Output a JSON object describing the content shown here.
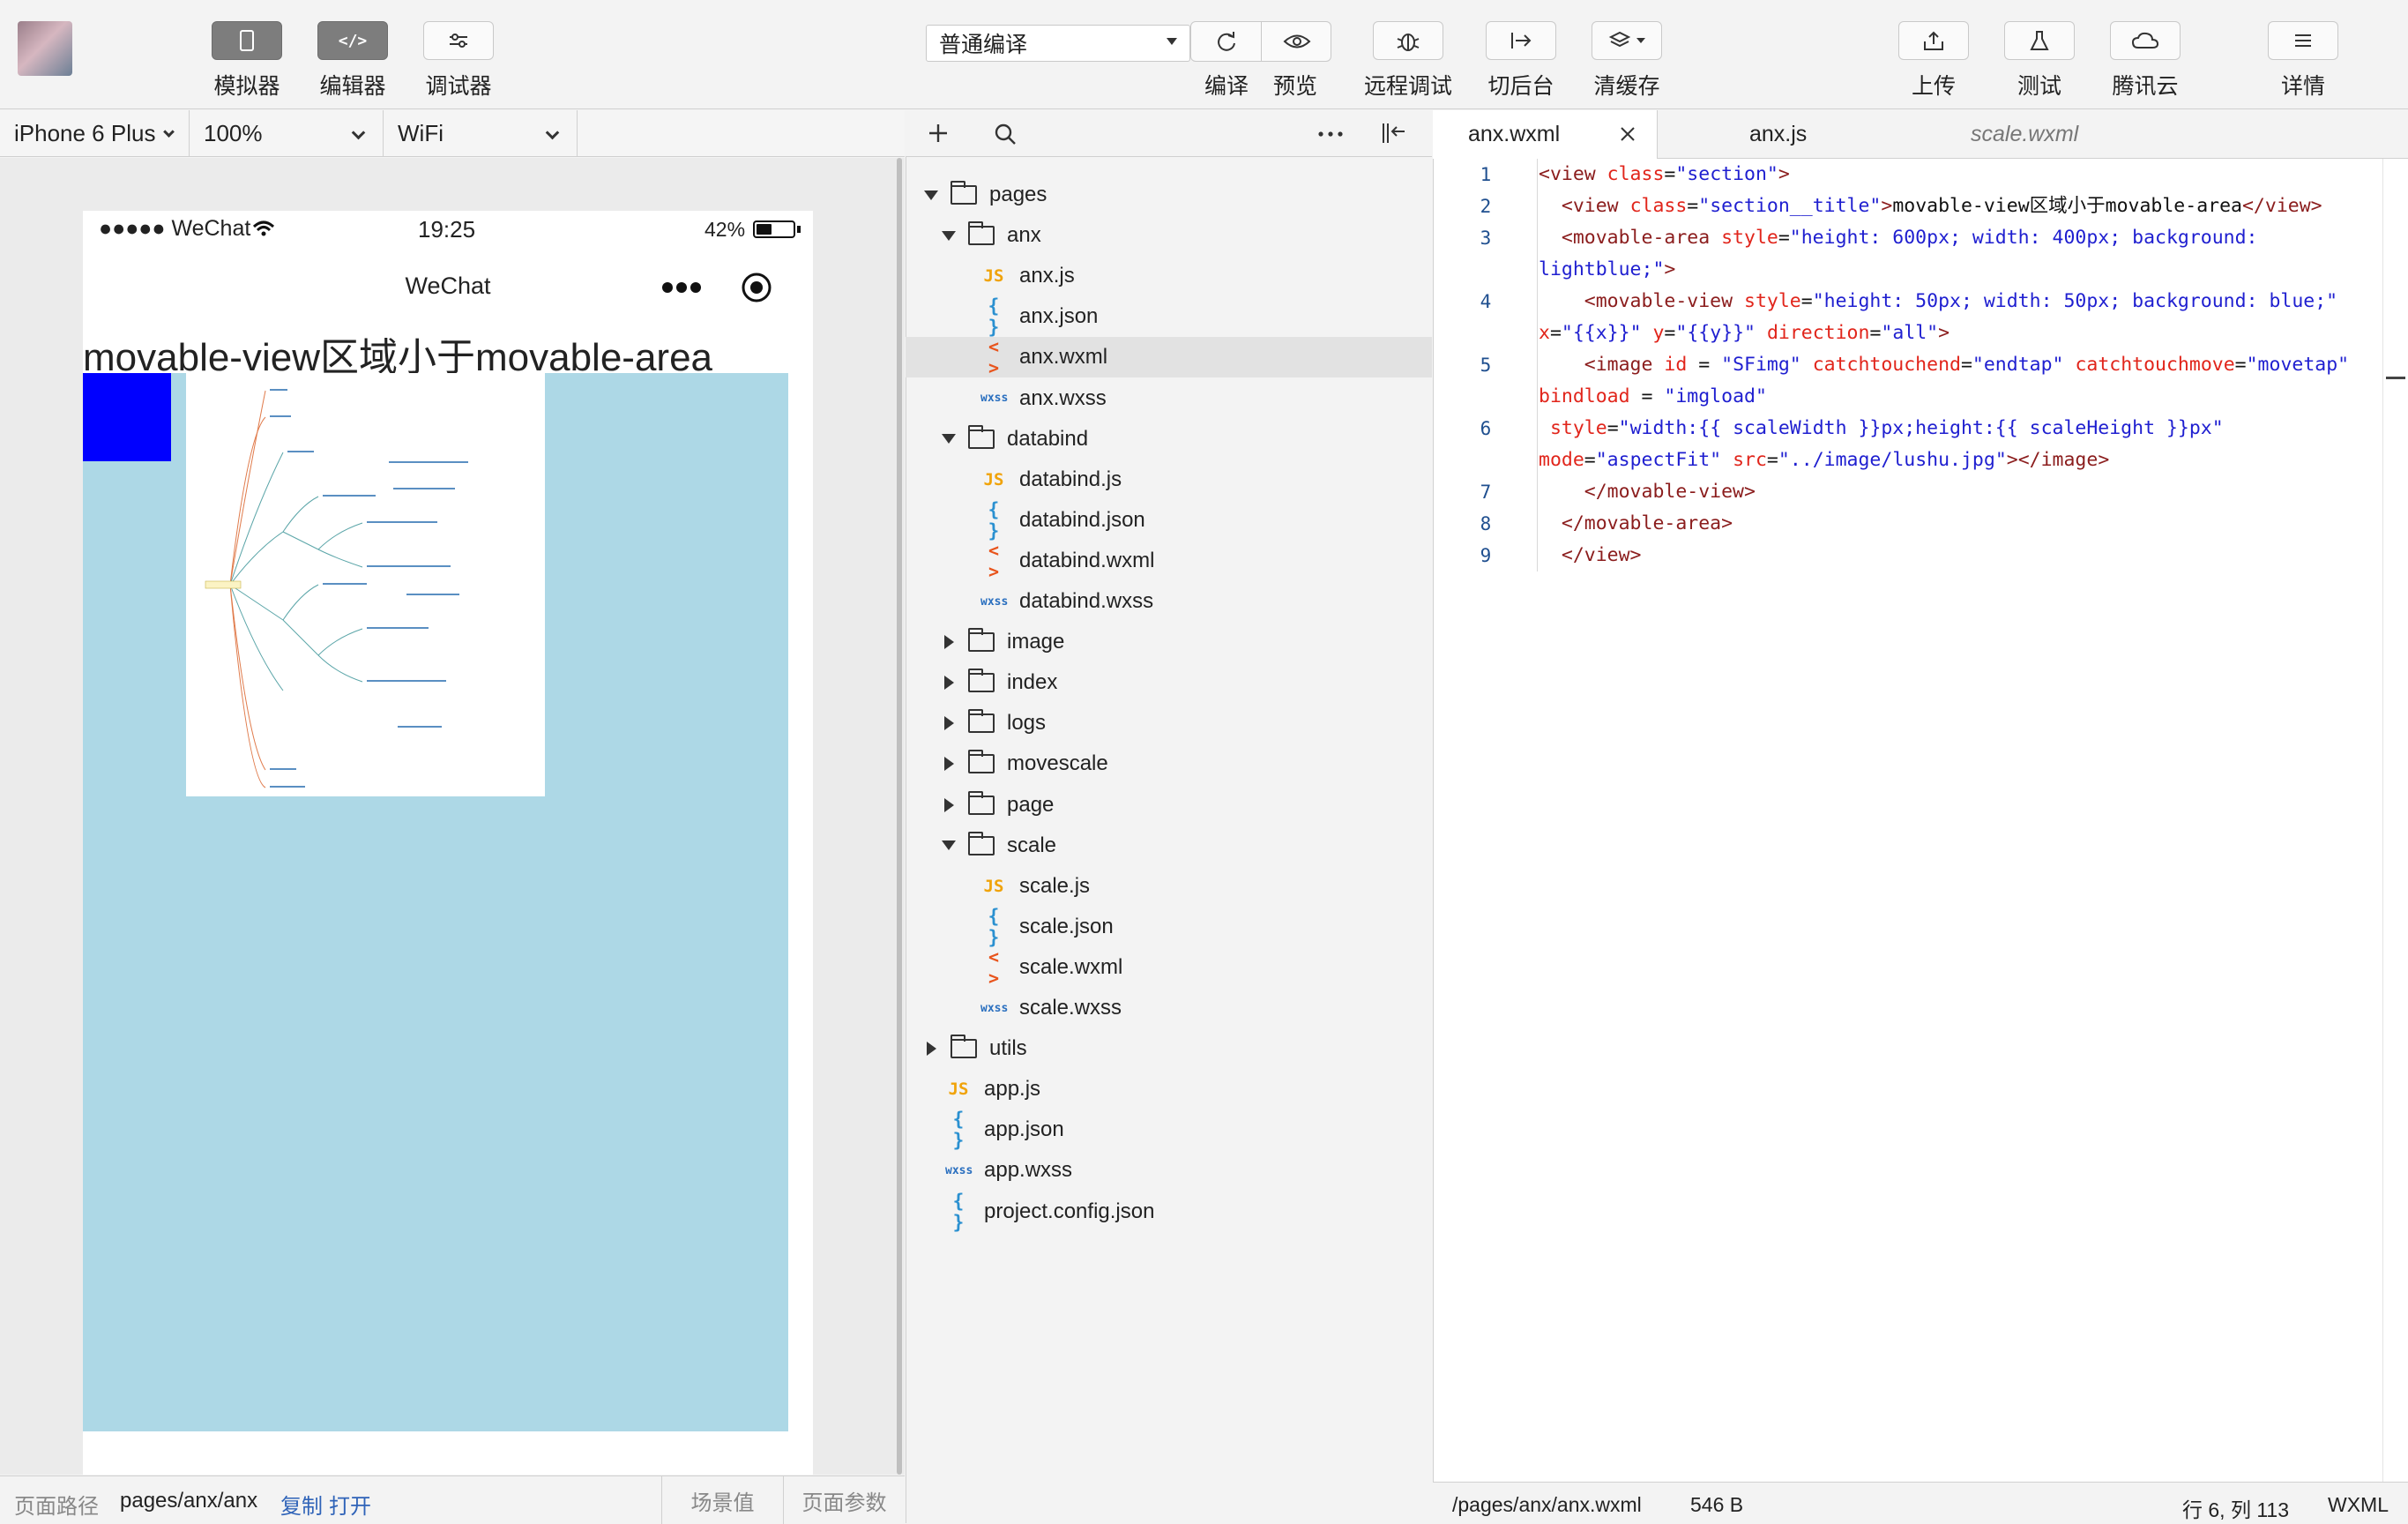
{
  "toolbar": {
    "left_buttons": [
      {
        "label": "模拟器",
        "icon": "phone-icon"
      },
      {
        "label": "编辑器",
        "icon": "code-icon"
      },
      {
        "label": "调试器",
        "icon": "sliders-icon"
      }
    ],
    "compile_mode": "普通编译",
    "mid_buttons": [
      {
        "label": "编译",
        "icon": "refresh-icon"
      },
      {
        "label": "预览",
        "icon": "eye-icon"
      },
      {
        "label": "远程调试",
        "icon": "bug-icon"
      },
      {
        "label": "切后台",
        "icon": "switch-icon"
      },
      {
        "label": "清缓存",
        "icon": "layers-icon"
      }
    ],
    "right_buttons": [
      {
        "label": "上传",
        "icon": "upload-icon"
      },
      {
        "label": "测试",
        "icon": "flask-icon"
      },
      {
        "label": "腾讯云",
        "icon": "cloud-icon"
      },
      {
        "label": "详情",
        "icon": "menu-icon"
      }
    ]
  },
  "device_bar": {
    "device": "iPhone 6 Plus",
    "zoom": "100%",
    "network": "WiFi"
  },
  "phone": {
    "carrier": "●●●●● WeChat",
    "time": "19:25",
    "battery": "42%",
    "battery_level": 0.42,
    "nav_title": "WeChat",
    "section_title": "movable-view区域小于movable-area"
  },
  "explorer": {
    "tree": [
      {
        "type": "folder",
        "name": "pages",
        "level": 0,
        "open": true
      },
      {
        "type": "folder",
        "name": "anx",
        "level": 1,
        "open": true
      },
      {
        "type": "js",
        "name": "anx.js",
        "level": 2
      },
      {
        "type": "json",
        "name": "anx.json",
        "level": 2
      },
      {
        "type": "wxml",
        "name": "anx.wxml",
        "level": 2,
        "selected": true
      },
      {
        "type": "wxss",
        "name": "anx.wxss",
        "level": 2
      },
      {
        "type": "folder",
        "name": "databind",
        "level": 1,
        "open": true
      },
      {
        "type": "js",
        "name": "databind.js",
        "level": 2
      },
      {
        "type": "json",
        "name": "databind.json",
        "level": 2
      },
      {
        "type": "wxml",
        "name": "databind.wxml",
        "level": 2
      },
      {
        "type": "wxss",
        "name": "databind.wxss",
        "level": 2
      },
      {
        "type": "folder",
        "name": "image",
        "level": 1,
        "open": false
      },
      {
        "type": "folder",
        "name": "index",
        "level": 1,
        "open": false
      },
      {
        "type": "folder",
        "name": "logs",
        "level": 1,
        "open": false
      },
      {
        "type": "folder",
        "name": "movescale",
        "level": 1,
        "open": false
      },
      {
        "type": "folder",
        "name": "page",
        "level": 1,
        "open": false
      },
      {
        "type": "folder",
        "name": "scale",
        "level": 1,
        "open": true
      },
      {
        "type": "js",
        "name": "scale.js",
        "level": 2
      },
      {
        "type": "json",
        "name": "scale.json",
        "level": 2
      },
      {
        "type": "wxml",
        "name": "scale.wxml",
        "level": 2
      },
      {
        "type": "wxss",
        "name": "scale.wxss",
        "level": 2
      },
      {
        "type": "folder",
        "name": "utils",
        "level": 0,
        "open": false
      },
      {
        "type": "js",
        "name": "app.js",
        "level": 0
      },
      {
        "type": "json",
        "name": "app.json",
        "level": 0
      },
      {
        "type": "wxss",
        "name": "app.wxss",
        "level": 0
      },
      {
        "type": "json",
        "name": "project.config.json",
        "level": 0
      }
    ]
  },
  "editor": {
    "tabs": [
      "anx.wxml",
      "anx.js",
      "scale.wxml"
    ],
    "line_numbers": [
      "1",
      "2",
      "3",
      "4",
      "5",
      "6",
      "7",
      "8",
      "9"
    ]
  },
  "sim_status": {
    "path_label": "页面路径",
    "path": "pages/anx/anx",
    "copy": "复制",
    "open": "打开",
    "scene": "场景值",
    "params": "页面参数"
  },
  "editor_status": {
    "path": "/pages/anx/anx.wxml",
    "size": "546 B",
    "position": "行 6, 列 113",
    "lang": "WXML"
  },
  "colors": {
    "movable_area": "#add8e6",
    "movable_view": "#0000ff",
    "wxml_icon": "#e8541c",
    "js_icon": "#f0a30a",
    "json_icon": "#2a90d0"
  }
}
